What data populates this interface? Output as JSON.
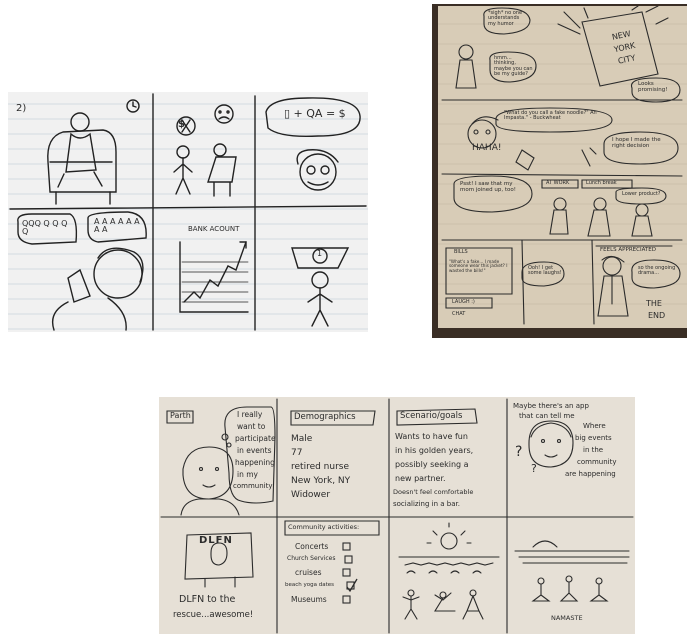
{
  "colors": {
    "page_background": "#ffffff",
    "lined_paper": "#f2f2f2",
    "rule_line": "#b7c4cf",
    "notebook_paper": "#d9cdb8",
    "notebook_edge": "#3a2e25",
    "card_paper": "#e8e3da",
    "ink": "#2b2b2b"
  },
  "photo1": {
    "panel_number": "2)",
    "bubble_formula": "▯ + QA = $",
    "bubble_chars_left": "QQQ Q Q Q Q",
    "bubble_chars_right": "A A A A A A A A",
    "bank_title": "BANK ACOUNT",
    "dollar_sign": "$",
    "coin_label": "1"
  },
  "photo2": {
    "bubble_top_left": "*sigh* no one understands my humor",
    "bubble_hmm": "hmm... thinking, maybe you can be my guide?",
    "phone_lines": [
      "NEW",
      "YORK",
      "CITY"
    ],
    "looks_promising": "Looks promising!",
    "fake_noodle": "\"What do you call a fake noodle?\" An Impasta.\" - Buckwheat",
    "haha": "HAHA!",
    "hope_bubble": "I hope I made the right decision",
    "at_work": "AT WORK",
    "lunch_break": "Lunch break",
    "pssst": "Psst! I saw that my mom joined up, too!",
    "lower_panel_speaker": "Lower product?",
    "bills_label": "BILLS",
    "bills_text": "\"What's a fake... I made someone wear this jacket? I wasted the bills!\"",
    "ooh_bubble": "Ooh! I get some laughs!",
    "laugh_label": "LAUGH :)",
    "feels_appreciated": "FEELS APPRECIATED",
    "ongoing_bubble": "so the ongoing drama...",
    "chat_label": "CHAT",
    "the_end": [
      "THE",
      "END"
    ]
  },
  "photo3": {
    "name": "Parth",
    "thought_bubble": [
      "I really",
      "want to",
      "participate",
      "in events",
      "happening",
      "in my",
      "community"
    ],
    "demographics_title": "Demographics",
    "demographics": [
      "Male",
      "77",
      "retired nurse",
      "New York, NY",
      "Widower"
    ],
    "scenario_title": "Scenario/goals",
    "scenario": [
      "Wants to have fun",
      "in his golden years,",
      "possibly seeking a",
      "new partner.",
      "Doesn't feel comfortable",
      "socializing in a bar."
    ],
    "app_idea": [
      "Maybe there's an app",
      "that can tell me"
    ],
    "app_idea_side": [
      "Where",
      "big events",
      "in the",
      "community",
      "are happening"
    ],
    "question_marks": [
      "?",
      "?"
    ],
    "dlfn_logo": "DLFN",
    "dlfn_caption": [
      "DLFN to the",
      "rescue...awesome!"
    ],
    "community_title": "Community activities:",
    "activities": [
      {
        "label": "Concerts",
        "checked": false
      },
      {
        "label": "Church Services",
        "checked": false
      },
      {
        "label": "cruises",
        "checked": false
      },
      {
        "label": "beach yoga dates",
        "checked": true
      },
      {
        "label": "Museums",
        "checked": false
      }
    ],
    "namaste": "NAMASTE"
  }
}
